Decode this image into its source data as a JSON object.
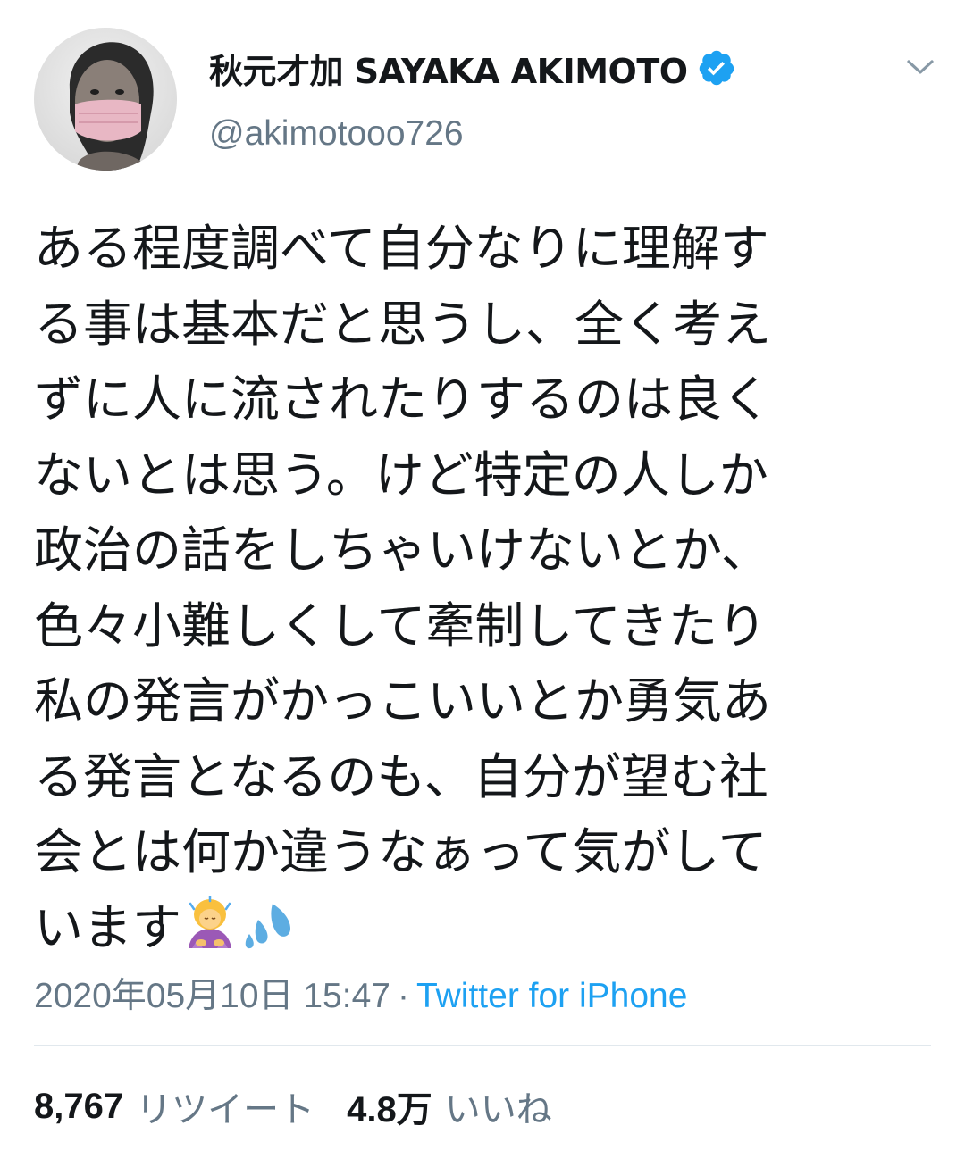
{
  "tweet": {
    "author": {
      "display_name": "秋元才加 SAYAKA AKIMOTO",
      "handle": "@akimotooo726",
      "verified_icon": "verified-badge-icon",
      "avatar_icon": "profile-photo"
    },
    "menu_icon": "chevron-down-icon",
    "text_lines": [
      "ある程度調べて自分なりに理解す",
      "る事は基本だと思うし、全く考え",
      "ずに人に流されたりするのは良く",
      "ないとは思う。けど特定の人しか",
      "政治の話をしちゃいけないとか、",
      "色々小難しくして牽制してきたり",
      "私の発言がかっこいいとか勇気あ",
      "る発言となるのも、自分が望む社",
      "会とは何か違うなぁって気がして",
      "います"
    ],
    "emojis": [
      "woman-bowing-emoji",
      "sweat-droplets-emoji"
    ],
    "timestamp": "2020年05月10日 15:47",
    "separator": "·",
    "source": "Twitter for iPhone",
    "stats": {
      "retweets_count": "8,767",
      "retweets_label": "リツイート",
      "likes_count": "4.8万",
      "likes_label": "いいね"
    },
    "colors": {
      "text": "#14171a",
      "muted": "#657786",
      "link": "#1da1f2",
      "verified": "#1da1f2",
      "divider": "#e1e8ed"
    }
  }
}
